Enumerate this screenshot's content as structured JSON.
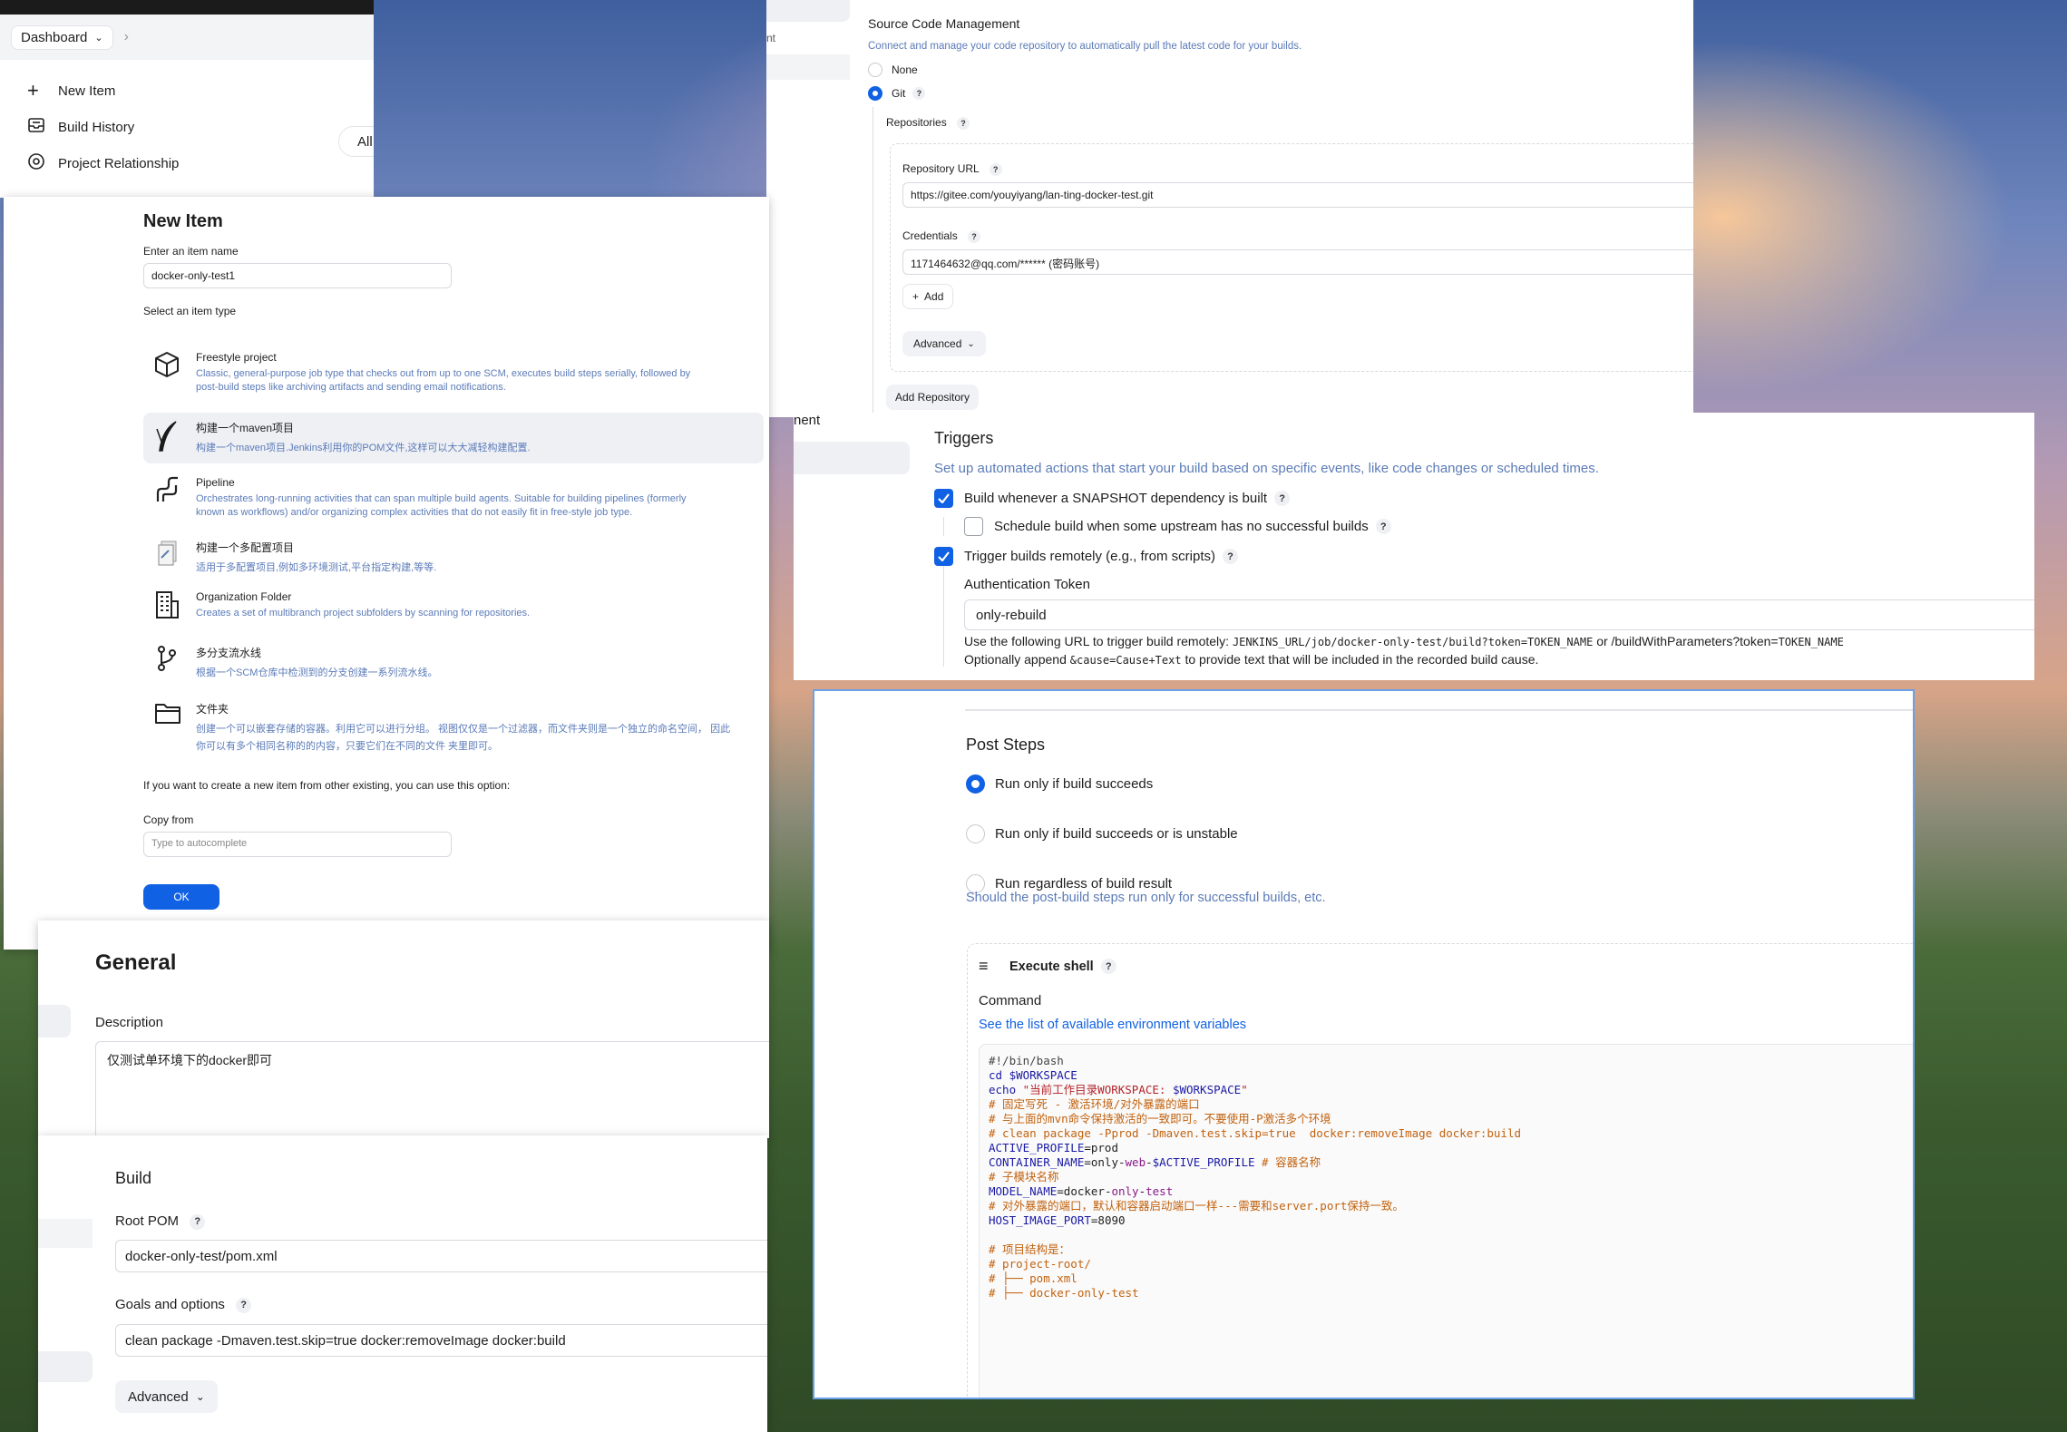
{
  "dashboard": {
    "breadcrumb": "Dashboard",
    "menu": [
      {
        "label": "New Item",
        "icon": "plus-icon"
      },
      {
        "label": "Build History",
        "icon": "inbox-icon"
      },
      {
        "label": "Project Relationship",
        "icon": "target-icon"
      }
    ],
    "filter_tab": "All"
  },
  "new_item": {
    "title": "New Item",
    "name_label": "Enter an item name",
    "name_value": "docker-only-test1",
    "type_label": "Select an item type",
    "types": [
      {
        "name": "Freestyle project",
        "desc": "Classic, general-purpose job type that checks out from up to one SCM, executes build steps serially, followed by",
        "desc2": "post-build steps like archiving artifacts and sending email notifications."
      },
      {
        "name": "构建一个maven项目",
        "desc": "构建一个maven项目.Jenkins利用你的POM文件,这样可以大大减轻构建配置.",
        "desc2": ""
      },
      {
        "name": "Pipeline",
        "desc": "Orchestrates long-running activities that can span multiple build agents. Suitable for building pipelines (formerly",
        "desc2": "known as workflows) and/or organizing complex activities that do not easily fit in free-style job type."
      },
      {
        "name": "构建一个多配置项目",
        "desc": "适用于多配置项目,例如多环境测试,平台指定构建,等等.",
        "desc2": ""
      },
      {
        "name": "Organization Folder",
        "desc": "Creates a set of multibranch project subfolders by scanning for repositories.",
        "desc2": ""
      },
      {
        "name": "多分支流水线",
        "desc": "根据一个SCM仓库中检测到的分支创建一系列流水线。",
        "desc2": ""
      },
      {
        "name": "文件夹",
        "desc": "创建一个可以嵌套存储的容器。利用它可以进行分组。 视图仅仅是一个过滤器，而文件夹则是一个独立的命名空间， 因此",
        "desc2": "你可以有多个相同名称的的内容，只要它们在不同的文件 夹里即可。"
      }
    ],
    "copy_hint": "If you want to create a new item from other existing, you can use this option:",
    "copy_label": "Copy from",
    "copy_placeholder": "Type to autocomplete",
    "ok": "OK"
  },
  "scm": {
    "title": "Source Code Management",
    "desc": "Connect and manage your code repository to automatically pull the latest code for your builds.",
    "none": "None",
    "git": "Git",
    "repositories": "Repositories",
    "repo_url_label": "Repository URL",
    "repo_url": "https://gitee.com/youyiyang/lan-ting-docker-test.git",
    "credentials_label": "Credentials",
    "credentials": "1171464632@qq.com/****** (密码账号)",
    "add": "Add",
    "advanced": "Advanced",
    "add_repo": "Add Repository",
    "side_fragment": "nt"
  },
  "triggers": {
    "side_fragment": "nent",
    "title": "Triggers",
    "desc": "Set up automated actions that start your build based on specific events, like code changes or scheduled times.",
    "snapshot": "Build whenever a SNAPSHOT dependency is built",
    "schedule": "Schedule build when some upstream has no successful builds",
    "remote": "Trigger builds remotely (e.g., from scripts)",
    "token_label": "Authentication Token",
    "token_value": "only-rebuild",
    "url_prefix": "Use the following URL to trigger build remotely: ",
    "url_code": "JENKINS_URL/job/docker-only-test/build?token=TOKEN_NAME",
    "url_or": " or /buildWithParameters?token=",
    "url_code2": "TOKEN_NAME",
    "append_prefix": "Optionally append ",
    "append_code": "&cause=Cause+Text",
    "append_suffix": " to provide text that will be included in the recorded build cause."
  },
  "general": {
    "title": "General",
    "desc_label": "Description",
    "desc_value": "仅测试单环境下的docker即可"
  },
  "build": {
    "title": "Build",
    "root_pom_label": "Root POM",
    "root_pom": "docker-only-test/pom.xml",
    "goals_label": "Goals and options",
    "goals": "clean package -Dmaven.test.skip=true docker:removeImage docker:build",
    "advanced": "Advanced"
  },
  "post": {
    "title": "Post Steps",
    "opt1": "Run only if build succeeds",
    "opt2": "Run only if build succeeds or is unstable",
    "opt3": "Run regardless of build result",
    "hint": "Should the post-build steps run only for successful builds, etc.",
    "shell_title": "Execute shell",
    "command_label": "Command",
    "see": "See ",
    "env_link": "the list of available environment variables",
    "code": [
      [
        {
          "t": "#!/bin/bash",
          "c": "#444"
        }
      ],
      [
        {
          "t": "cd ",
          "c": "#1a1aa6"
        },
        {
          "t": "$WORKSPACE",
          "c": "#1a1aa6"
        }
      ],
      [
        {
          "t": "echo ",
          "c": "#1a1aa6"
        },
        {
          "t": "\"当前工作目录WORKSPACE: ",
          "c": "#b4232a"
        },
        {
          "t": "$WORKSPACE",
          "c": "#1a1aa6"
        },
        {
          "t": "\"",
          "c": "#b4232a"
        }
      ],
      [
        {
          "t": "# 固定写死 - 激活环境/对外暴露的端口",
          "c": "#c2620f"
        }
      ],
      [
        {
          "t": "# 与上面的mvn命令保持激活的一致即可。不要使用-P激活多个环境",
          "c": "#c2620f"
        }
      ],
      [
        {
          "t": "# clean package -Pprod -Dmaven.test.skip=true  docker:removeImage docker:build",
          "c": "#c2620f"
        }
      ],
      [
        {
          "t": "ACTIVE_PROFILE",
          "c": "#1a1aa6"
        },
        {
          "t": "=prod",
          "c": "#222"
        }
      ],
      [
        {
          "t": "CONTAINER_NAME",
          "c": "#1a1aa6"
        },
        {
          "t": "=only-",
          "c": "#222"
        },
        {
          "t": "web",
          "c": "#8a1a8a"
        },
        {
          "t": "-",
          "c": "#222"
        },
        {
          "t": "$ACTIVE_PROFILE",
          "c": "#1a1aa6"
        },
        {
          "t": " # 容器名称",
          "c": "#c2620f"
        }
      ],
      [
        {
          "t": "# 子模块名称",
          "c": "#c2620f"
        }
      ],
      [
        {
          "t": "MODEL_NAME",
          "c": "#1a1aa6"
        },
        {
          "t": "=docker-",
          "c": "#222"
        },
        {
          "t": "only",
          "c": "#8a1a8a"
        },
        {
          "t": "-",
          "c": "#222"
        },
        {
          "t": "test",
          "c": "#8a1a8a"
        }
      ],
      [
        {
          "t": "# 对外暴露的端口，默认和容器启动端口一样---需要和server.port保持一致。",
          "c": "#c2620f"
        }
      ],
      [
        {
          "t": "HOST_IMAGE_PORT",
          "c": "#1a1aa6"
        },
        {
          "t": "=8090",
          "c": "#222"
        }
      ],
      [
        {
          "t": "",
          "c": "#222"
        }
      ],
      [
        {
          "t": "# 项目结构是：",
          "c": "#c2620f"
        }
      ],
      [
        {
          "t": "# project-root/",
          "c": "#c2620f"
        }
      ],
      [
        {
          "t": "# ├── pom.xml",
          "c": "#c2620f"
        }
      ],
      [
        {
          "t": "# ├── docker-only-test",
          "c": "#c2620f"
        }
      ]
    ]
  }
}
